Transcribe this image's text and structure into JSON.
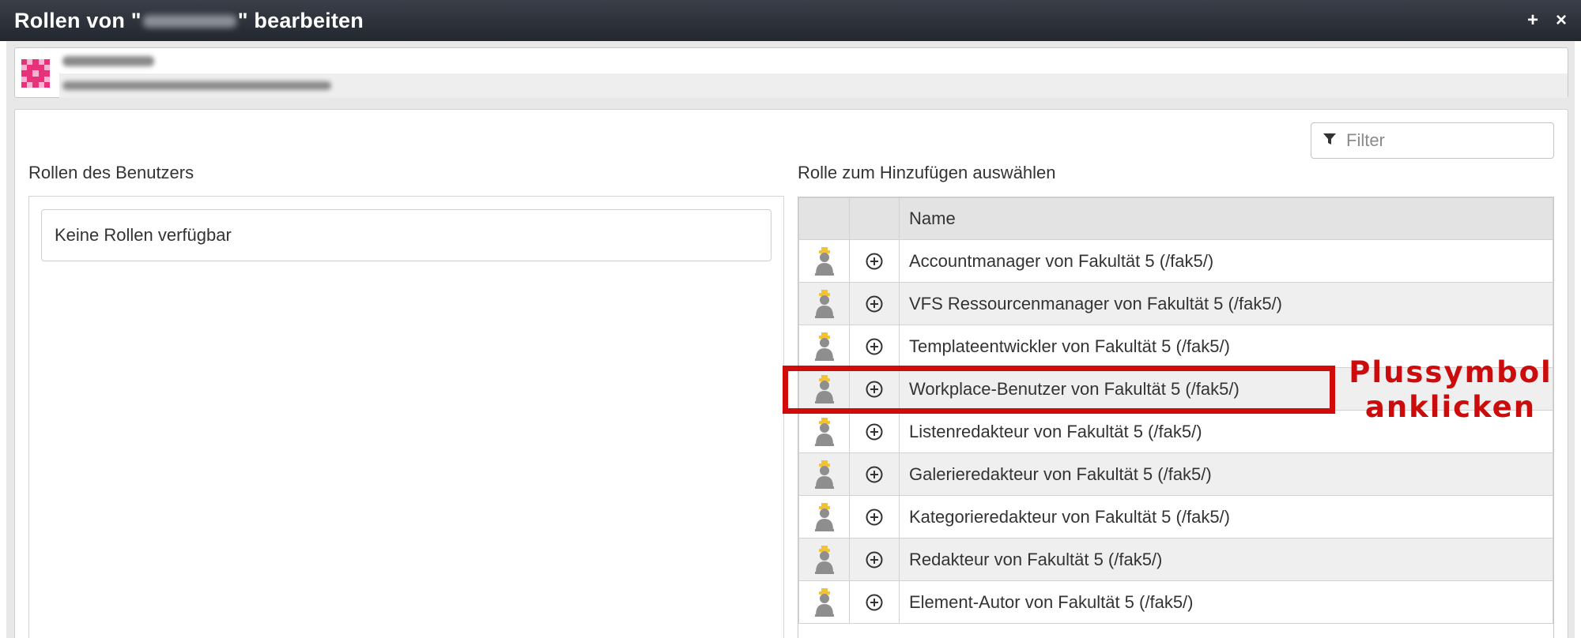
{
  "window": {
    "title_prefix": "Rollen von \"",
    "title_suffix": "\" bearbeiten",
    "add_control": "+",
    "close_control": "×"
  },
  "filter": {
    "placeholder": "Filter"
  },
  "left": {
    "heading": "Rollen des Benutzers",
    "empty_message": "Keine Rollen verfügbar"
  },
  "right": {
    "heading": "Rolle zum Hinzufügen auswählen",
    "columns": {
      "name": "Name"
    },
    "rows": [
      {
        "name": "Accountmanager von Fakultät 5 (/fak5/)"
      },
      {
        "name": "VFS Ressourcenmanager von Fakultät 5 (/fak5/)"
      },
      {
        "name": "Templateentwickler von Fakultät 5 (/fak5/)"
      },
      {
        "name": "Workplace-Benutzer von Fakultät 5 (/fak5/)"
      },
      {
        "name": "Listenredakteur von Fakultät 5 (/fak5/)"
      },
      {
        "name": "Galerieredakteur von Fakultät 5 (/fak5/)"
      },
      {
        "name": "Kategorieredakteur von Fakultät 5 (/fak5/)"
      },
      {
        "name": "Redakteur von Fakultät 5 (/fak5/)"
      },
      {
        "name": "Element-Autor von Fakultät 5 (/fak5/)"
      }
    ]
  },
  "annotation": {
    "line1": "Plussymbol",
    "line2": "anklicken",
    "color": "#cc0c0c"
  },
  "icons": {
    "role": "person-icon",
    "add": "plus-circle-icon",
    "filter": "filter-icon"
  }
}
